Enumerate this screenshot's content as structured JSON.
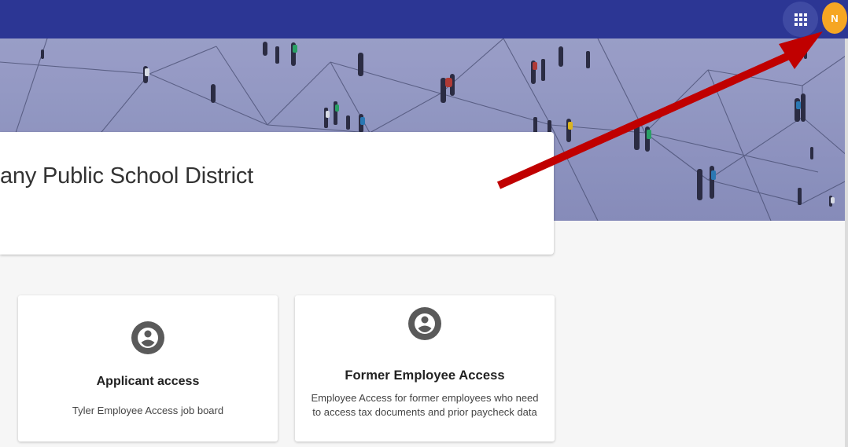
{
  "header": {
    "apps_icon": "apps-grid-icon",
    "avatar_initial": "N",
    "colors": {
      "bar": "#2c3694",
      "avatar": "#f6a623"
    }
  },
  "banner": {
    "title": "any Public School District"
  },
  "cards": [
    {
      "icon": "account-circle-icon",
      "title": "Applicant access",
      "description": "Tyler Employee Access job board"
    },
    {
      "icon": "account-circle-icon",
      "title": "Former Employee Access",
      "description": "Employee Access for former employees who need to access tax documents and prior paycheck data"
    }
  ],
  "annotation": {
    "color": "#c00000",
    "icon": "red-arrow"
  }
}
